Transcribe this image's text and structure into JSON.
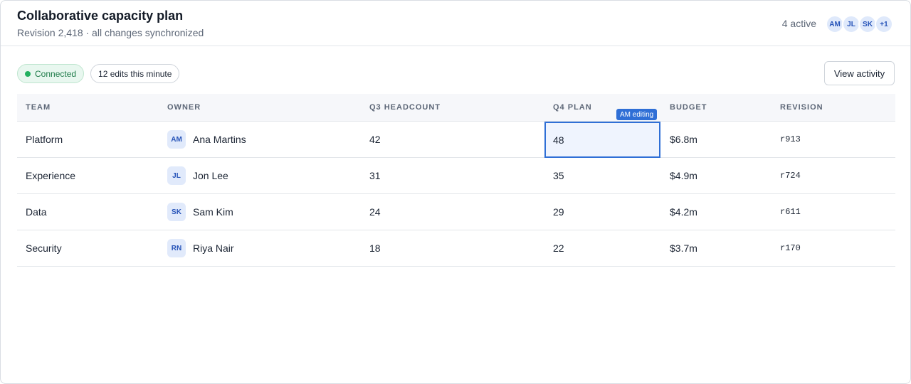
{
  "header": {
    "title": "Collaborative capacity plan",
    "subtitle": "Revision 2,418 · all changes synchronized",
    "active_count": "4 active",
    "presence": [
      "AM",
      "JL",
      "SK",
      "+1"
    ]
  },
  "toolbar": {
    "status": "Connected",
    "edits": "12 edits this minute",
    "activity_button": "View activity"
  },
  "table": {
    "columns": [
      "TEAM",
      "OWNER",
      "Q3 HEADCOUNT",
      "Q4 PLAN",
      "BUDGET",
      "REVISION"
    ],
    "rows": [
      {
        "team": "Platform",
        "owner_initials": "AM",
        "owner": "Ana Martins",
        "q3": "42",
        "q4": "48",
        "budget": "$6.8m",
        "revision": "r913"
      },
      {
        "team": "Experience",
        "owner_initials": "JL",
        "owner": "Jon Lee",
        "q3": "31",
        "q4": "35",
        "budget": "$4.9m",
        "revision": "r724"
      },
      {
        "team": "Data",
        "owner_initials": "SK",
        "owner": "Sam Kim",
        "q3": "24",
        "q4": "29",
        "budget": "$4.2m",
        "revision": "r611"
      },
      {
        "team": "Security",
        "owner_initials": "RN",
        "owner": "Riya Nair",
        "q3": "18",
        "q4": "22",
        "budget": "$3.7m",
        "revision": "r170"
      }
    ],
    "editing_label": "AM editing"
  },
  "colors": {
    "accent": "#2f6fd6",
    "connected": "#22b05f"
  }
}
